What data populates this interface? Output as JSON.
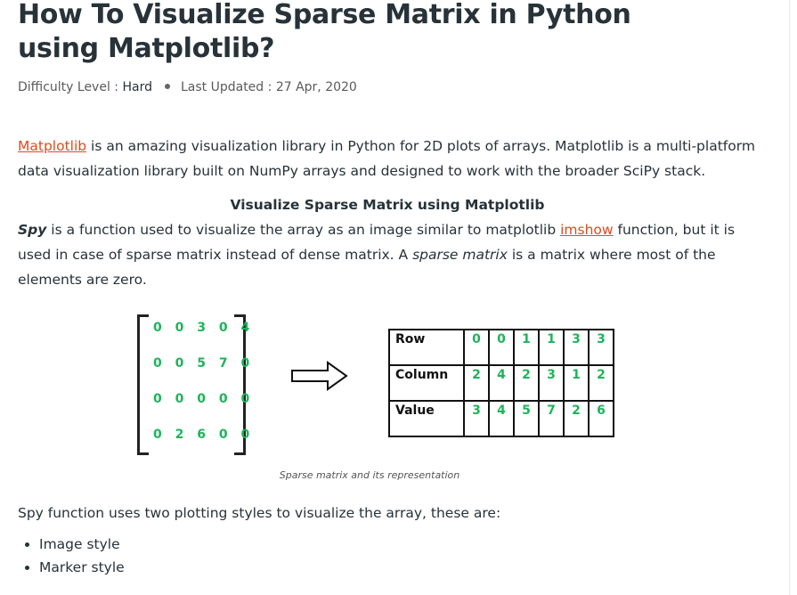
{
  "title": "How To Visualize Sparse Matrix in Python using Matplotlib?",
  "meta": {
    "difficulty_label": "Difficulty Level :",
    "difficulty": "Hard",
    "updated_label": "Last Updated :",
    "updated": "27 Apr, 2020"
  },
  "intro": {
    "link": "Matplotlib",
    "text": " is an amazing visualization library in Python for 2D plots of arrays. Matplotlib is a multi-platform data visualization library built on NumPy arrays and designed to work with the broader SciPy stack."
  },
  "section_heading": "Visualize Sparse Matrix using Matplotlib",
  "spy": {
    "term": "Spy",
    "text1": " is a function used to visualize the array as an image similar to matplotlib ",
    "link": "imshow",
    "text2": " function, but it is used in case of sparse matrix instead of dense matrix. A ",
    "em": "sparse matrix",
    "text3": " is a matrix where most of the elements are zero."
  },
  "figure": {
    "matrix": [
      "0 0 3 0 4",
      "0 0 5 7 0",
      "0 0 0 0 0",
      "0 2 6 0 0"
    ],
    "table": [
      {
        "label": "Row",
        "values": [
          "0",
          "0",
          "1",
          "1",
          "3",
          "3"
        ]
      },
      {
        "label": "Column",
        "values": [
          "2",
          "4",
          "2",
          "3",
          "1",
          "2"
        ]
      },
      {
        "label": "Value",
        "values": [
          "3",
          "4",
          "5",
          "7",
          "2",
          "6"
        ]
      }
    ],
    "caption": "Sparse matrix and its representation"
  },
  "styles_intro": "Spy function uses two plotting styles to visualize the array, these are:",
  "styles": [
    "Image style",
    "Marker style"
  ]
}
